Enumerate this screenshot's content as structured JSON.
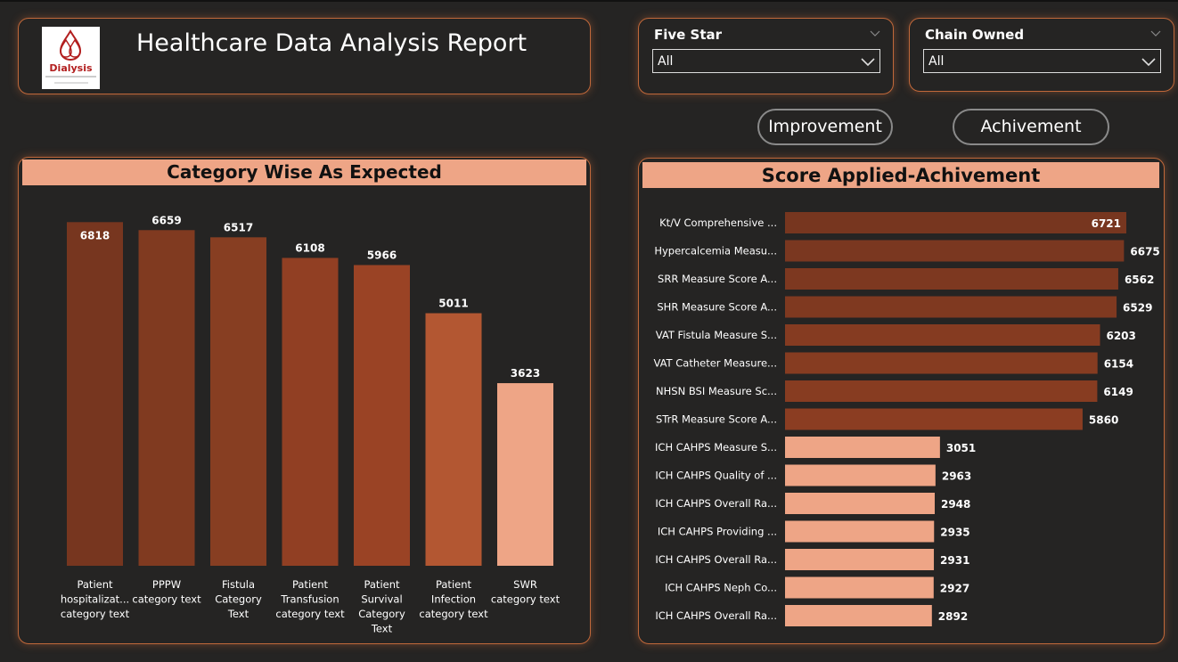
{
  "report": {
    "title": "Healthcare Data Analysis Report"
  },
  "logo": {
    "name": "Dialysis",
    "color": "#b21e1e"
  },
  "slicers": [
    {
      "title": "Five Star",
      "value": "All"
    },
    {
      "title": "Chain Owned",
      "value": "All"
    }
  ],
  "buttons": {
    "improvement": "Improvement",
    "achievement": "Achivement"
  },
  "colors": {
    "accent": "#c0683a",
    "header_bg": "#eea586",
    "background": "#252423"
  },
  "chart_data": [
    {
      "type": "bar",
      "title": "Category Wise As Expected",
      "categories": [
        [
          "Patient",
          "hospitalizat...",
          "category text"
        ],
        [
          "PPPW",
          "category text"
        ],
        [
          "Fistula",
          "Category",
          "Text"
        ],
        [
          "Patient",
          "Transfusion",
          "category text"
        ],
        [
          "Patient",
          "Survival",
          "Category",
          "Text"
        ],
        [
          "Patient",
          "Infection",
          "category text"
        ],
        [
          "SWR",
          "category text"
        ]
      ],
      "values": [
        6818,
        6659,
        6517,
        6108,
        5966,
        5011,
        3623
      ],
      "colors": [
        "#77361f",
        "#803a20",
        "#873e22",
        "#913f23",
        "#9a4325",
        "#b35732",
        "#eea586"
      ],
      "ylim": [
        0,
        7000
      ],
      "data_labels": true,
      "grid": false
    },
    {
      "type": "bar",
      "orientation": "horizontal",
      "title": "Score Applied-Achivement",
      "categories": [
        "Kt/V Comprehensive ...",
        "Hypercalcemia Measu...",
        "SRR Measure Score A...",
        "SHR Measure Score A...",
        "VAT Fistula Measure S...",
        "VAT Catheter Measure...",
        "NHSN BSI Measure Sc...",
        "STrR Measure Score A...",
        "ICH CAHPS Measure S...",
        "ICH CAHPS Quality of ...",
        "ICH CAHPS Overall Ra...",
        "ICH CAHPS Providing ...",
        "ICH CAHPS Overall Ra...",
        "ICH CAHPS Neph Co...",
        "ICH CAHPS Overall Ra..."
      ],
      "values": [
        6721,
        6675,
        6562,
        6529,
        6203,
        6154,
        6149,
        5860,
        3051,
        2963,
        2948,
        2935,
        2931,
        2927,
        2892
      ],
      "colors": [
        "#77361f",
        "#7a3720",
        "#7d3820",
        "#7f3920",
        "#853b21",
        "#863c21",
        "#873c21",
        "#8b3d22",
        "#eea586",
        "#eea586",
        "#eea586",
        "#eea586",
        "#eea586",
        "#eea586",
        "#eea586"
      ],
      "xlim": [
        0,
        6721
      ],
      "data_labels": true,
      "grid": false
    }
  ]
}
